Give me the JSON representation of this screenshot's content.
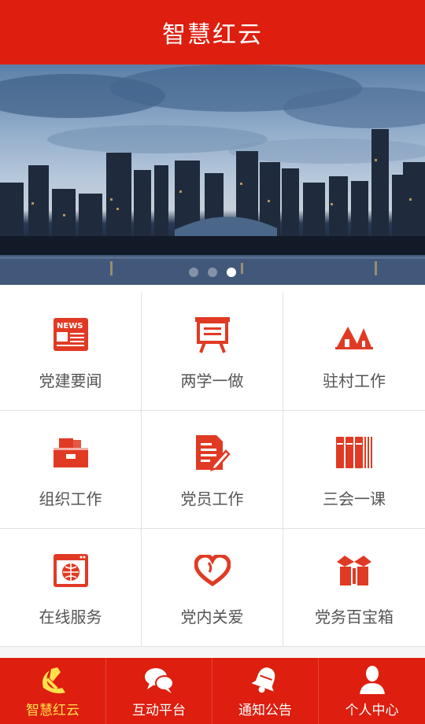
{
  "header": {
    "title": "智慧红云"
  },
  "banner": {
    "slides": 3,
    "active_slide": 3
  },
  "menu": {
    "items": [
      {
        "label": "党建要闻",
        "icon": "news-icon"
      },
      {
        "label": "两学一做",
        "icon": "easel-board-icon"
      },
      {
        "label": "驻村工作",
        "icon": "village-house-icon"
      },
      {
        "label": "组织工作",
        "icon": "folder-box-icon"
      },
      {
        "label": "党员工作",
        "icon": "document-pen-icon"
      },
      {
        "label": "三会一课",
        "icon": "books-icon"
      },
      {
        "label": "在线服务",
        "icon": "browser-globe-icon"
      },
      {
        "label": "党内关爱",
        "icon": "heart-icon"
      },
      {
        "label": "党务百宝箱",
        "icon": "gift-box-icon"
      }
    ]
  },
  "tabbar": {
    "items": [
      {
        "label": "智慧红云",
        "icon": "party-emblem-icon",
        "active": true
      },
      {
        "label": "互动平台",
        "icon": "chat-bubbles-icon",
        "active": false
      },
      {
        "label": "通知公告",
        "icon": "bell-icon",
        "active": false
      },
      {
        "label": "个人中心",
        "icon": "person-icon",
        "active": false
      }
    ]
  },
  "colors": {
    "brand_red": "#de1e0f",
    "icon_red": "#e13a24",
    "active_tab_text": "#ffe14a"
  }
}
